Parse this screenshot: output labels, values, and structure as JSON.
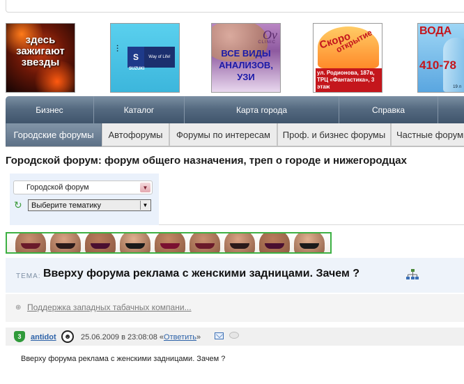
{
  "banners": {
    "b1_text": "здесь зажигают звезды",
    "b2_slogan": "Way of Life!",
    "b2_brand": "SUZUKI",
    "b3_logo": "Ov",
    "b3_clinic": "CLINIC",
    "b3_text": "ВСЕ ВИДЫ АНАЛИЗОВ, УЗИ",
    "b4_word1": "Скоро",
    "b4_word2": "открытие",
    "b4_address": "ул. Родионова, 187в, ТРЦ «Фантастика», 3 этаж",
    "b5_title": "ВОДА",
    "b5_phone": "410-78"
  },
  "mainnav": [
    "Бизнес",
    "Каталог",
    "Карта города",
    "Справка"
  ],
  "tabs": [
    "Городские форумы",
    "Автофорумы",
    "Форумы по интересам",
    "Проф. и бизнес форумы",
    "Частные форумы"
  ],
  "page_title": "Городской форум: форум общего назначения, треп о городе и нижегородцах",
  "selectors": {
    "forum_selected": "Городской форум",
    "theme_placeholder": "Выберите тематику"
  },
  "topic": {
    "label": "ТЕМА:",
    "title": "Вверху форума реклама с женскими задницами. Зачем ?"
  },
  "related_link": "Поддержка западных табачных компани...",
  "post": {
    "rank": "3",
    "author": "antidot",
    "date": "25.06.2009 в 23:08:08",
    "reply_label": "Ответить",
    "text": "Вверху форума реклама с женскими задницами. Зачем ?"
  },
  "colors": {
    "nav": "#556a80",
    "link": "#2d62a8",
    "ad_border": "#3cb043",
    "topic_band": "#eef3fa"
  }
}
